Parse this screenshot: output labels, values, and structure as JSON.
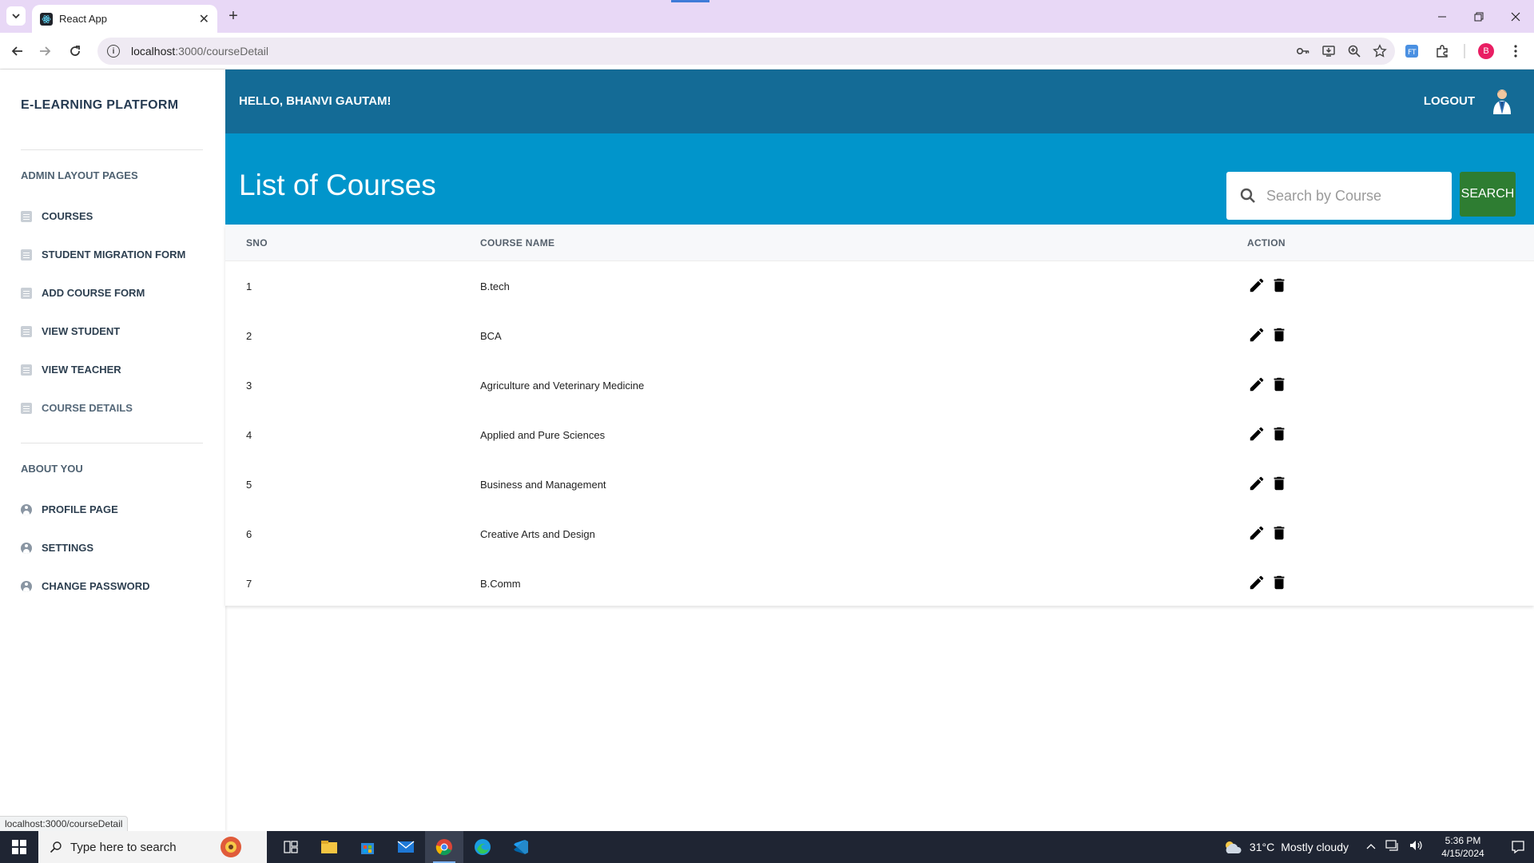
{
  "browser": {
    "tab_title": "React App",
    "url_host": "localhost",
    "url_rest": ":3000/courseDetail",
    "status_url": "localhost:3000/courseDetail",
    "profile_initial": "B"
  },
  "sidebar": {
    "brand": "E-LEARNING PLATFORM",
    "section_admin": "ADMIN LAYOUT PAGES",
    "admin_items": [
      {
        "label": "COURSES",
        "icon": "document-icon"
      },
      {
        "label": "STUDENT MIGRATION FORM",
        "icon": "document-icon"
      },
      {
        "label": "ADD COURSE FORM",
        "icon": "document-icon"
      },
      {
        "label": "VIEW STUDENT",
        "icon": "document-icon"
      },
      {
        "label": "VIEW TEACHER",
        "icon": "document-icon"
      },
      {
        "label": "COURSE DETAILS",
        "icon": "document-icon"
      }
    ],
    "section_about": "ABOUT YOU",
    "about_items": [
      {
        "label": "PROFILE PAGE",
        "icon": "account-circle-icon"
      },
      {
        "label": "SETTINGS",
        "icon": "account-circle-icon"
      },
      {
        "label": "CHANGE PASSWORD",
        "icon": "account-circle-icon"
      }
    ]
  },
  "header": {
    "greeting": "HELLO, BHANVI GAUTAM!",
    "logout": "LOGOUT"
  },
  "banner": {
    "title": "List of Courses",
    "search_placeholder": "Search by Course",
    "search_button": "SEARCH"
  },
  "table": {
    "columns": [
      "SNO",
      "COURSE NAME",
      "ACTION"
    ],
    "rows": [
      {
        "sno": "1",
        "name": "B.tech"
      },
      {
        "sno": "2",
        "name": "BCA"
      },
      {
        "sno": "3",
        "name": "Agriculture and Veterinary Medicine"
      },
      {
        "sno": "4",
        "name": "Applied and Pure Sciences"
      },
      {
        "sno": "5",
        "name": "Business and Management"
      },
      {
        "sno": "6",
        "name": "Creative Arts and Design"
      },
      {
        "sno": "7",
        "name": "B.Comm"
      }
    ]
  },
  "taskbar": {
    "search_placeholder": "Type here to search",
    "temperature": "31°C",
    "weather": "Mostly cloudy",
    "time": "5:36 PM",
    "date": "4/15/2024"
  },
  "colors": {
    "topbar": "#146b96",
    "banner": "#0195cb",
    "search_button": "#2e7d32",
    "tabbar": "#e8d8f6"
  }
}
